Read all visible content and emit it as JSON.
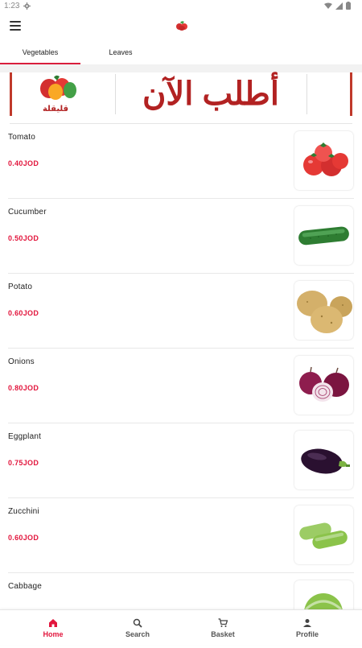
{
  "status": {
    "time": "1:23"
  },
  "tabs": [
    {
      "label": "Vegetables",
      "active": true
    },
    {
      "label": "Leaves",
      "active": false
    }
  ],
  "banner": {
    "text": "أطلب الآن",
    "logo_text": "قليقلة"
  },
  "products": [
    {
      "name": "Tomato",
      "price": "0.40JOD",
      "icon": "tomato"
    },
    {
      "name": "Cucumber",
      "price": "0.50JOD",
      "icon": "cucumber"
    },
    {
      "name": "Potato",
      "price": "0.60JOD",
      "icon": "potato"
    },
    {
      "name": "Onions",
      "price": "0.80JOD",
      "icon": "onion"
    },
    {
      "name": "Eggplant",
      "price": "0.75JOD",
      "icon": "eggplant"
    },
    {
      "name": "Zucchini",
      "price": "0.60JOD",
      "icon": "zucchini"
    },
    {
      "name": "Cabbage",
      "price": "",
      "icon": "cabbage"
    }
  ],
  "nav": [
    {
      "label": "Home",
      "icon": "home-icon",
      "active": true
    },
    {
      "label": "Search",
      "icon": "search-icon",
      "active": false
    },
    {
      "label": "Basket",
      "icon": "basket-icon",
      "active": false
    },
    {
      "label": "Profile",
      "icon": "profile-icon",
      "active": false
    }
  ],
  "colors": {
    "accent": "#e2163d",
    "banner_text": "#b22222"
  }
}
